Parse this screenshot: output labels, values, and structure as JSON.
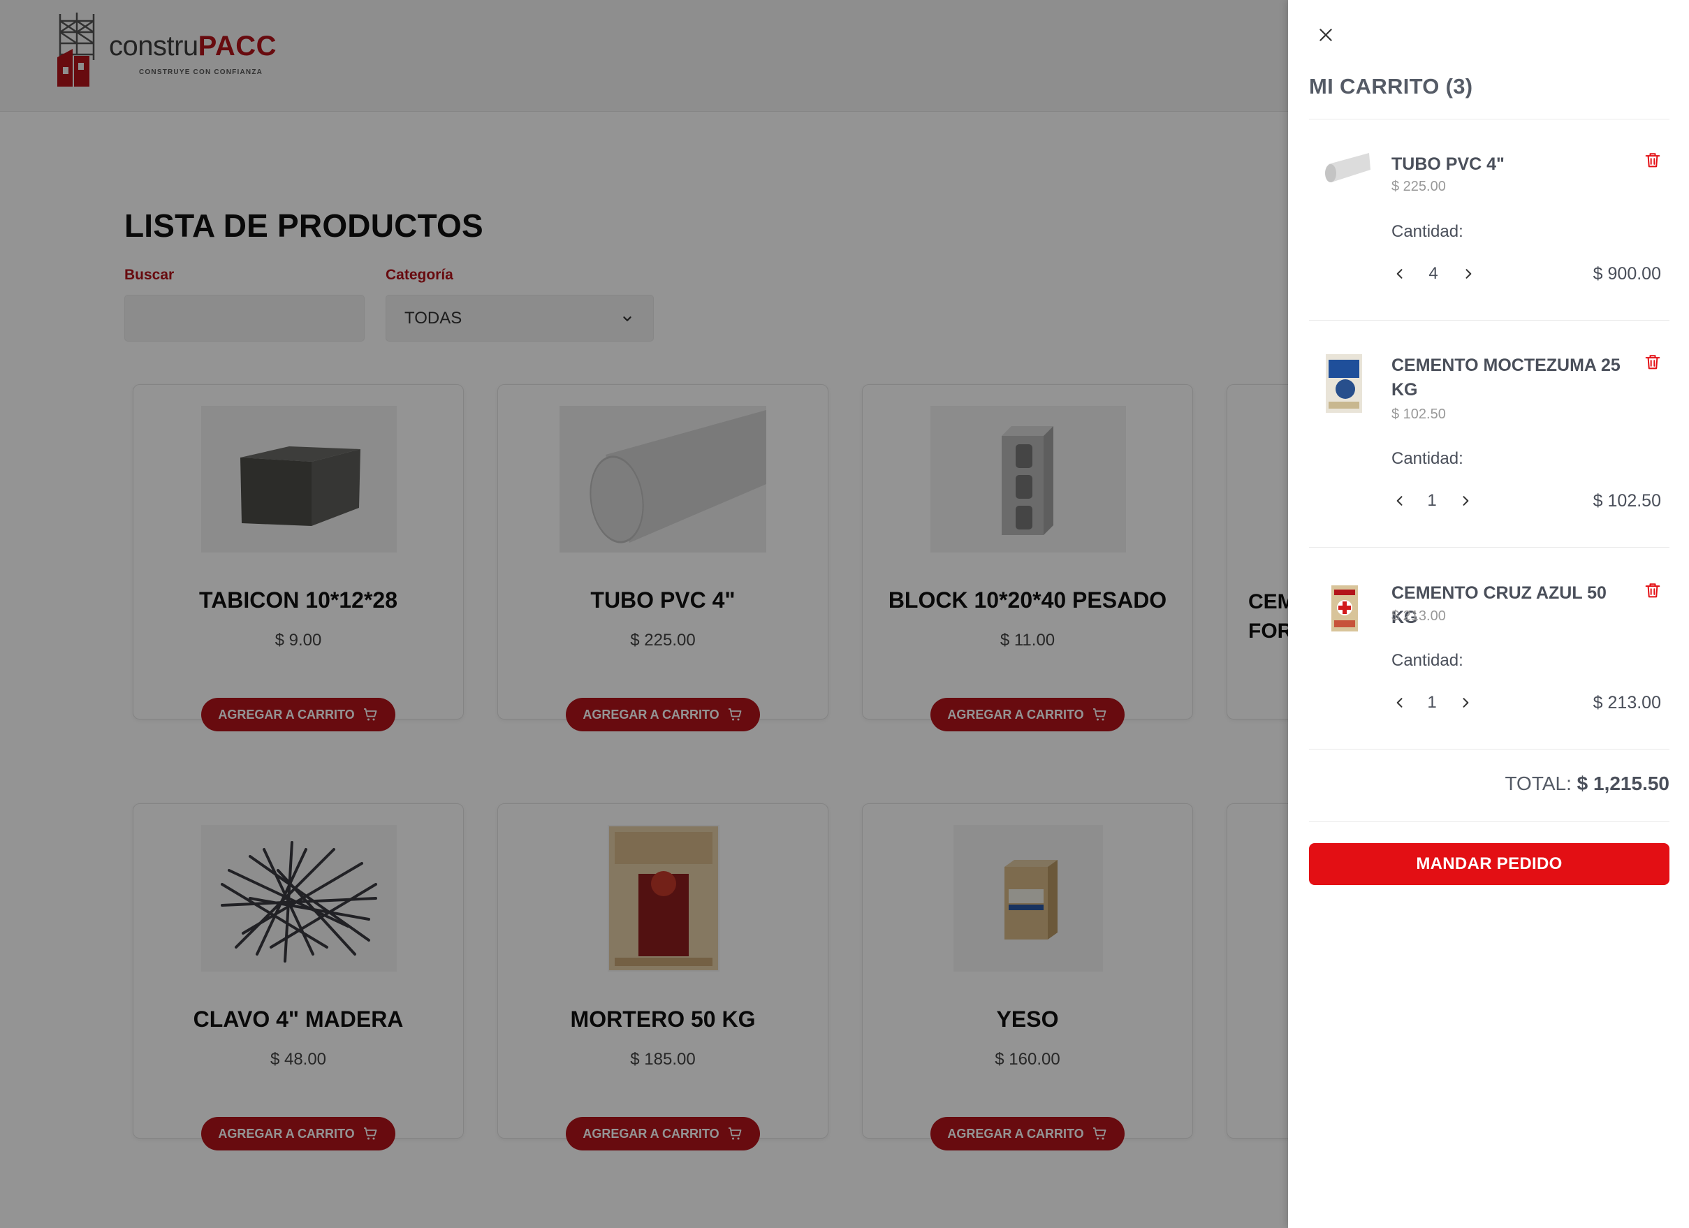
{
  "brand": {
    "name_part1": "constru",
    "name_part2": "PACC",
    "tagline": "CONSTRUYE CON CONFIANZA",
    "colors": {
      "primary": "#b3141b",
      "cta": "#e30f14",
      "dark": "#3d3d3d"
    }
  },
  "main": {
    "title": "LISTA DE PRODUCTOS",
    "search": {
      "label": "Buscar",
      "value": "",
      "placeholder": ""
    },
    "category": {
      "label": "Categoría",
      "selected": "TODAS"
    },
    "add_to_cart_label": "AGREGAR A CARRITO",
    "products": [
      {
        "name": "TABICON 10*12*28",
        "price": "$ 9.00",
        "image_icon": "concrete-brick-icon"
      },
      {
        "name": "TUBO PVC 4\"",
        "price": "$ 225.00",
        "image_icon": "pvc-pipe-icon"
      },
      {
        "name": "BLOCK 10*20*40 PESADO",
        "price": "$ 11.00",
        "image_icon": "cinder-block-icon"
      },
      {
        "name": "CEM\nFOR",
        "price": "",
        "image_icon": ""
      },
      {
        "name": "CLAVO 4\" MADERA",
        "price": "$ 48.00",
        "image_icon": "nails-icon"
      },
      {
        "name": "MORTERO 50 KG",
        "price": "$ 185.00",
        "image_icon": "mortar-bag-icon"
      },
      {
        "name": "YESO",
        "price": "$ 160.00",
        "image_icon": "plaster-bag-icon"
      }
    ]
  },
  "cart": {
    "title": "MI CARRITO (3)",
    "quantity_label": "Cantidad:",
    "items": [
      {
        "name": "TUBO PVC 4\"",
        "unit_price": "$ 225.00",
        "quantity": "4",
        "subtotal": "$ 900.00",
        "image_icon": "pvc-pipe-icon"
      },
      {
        "name": "CEMENTO MOCTEZUMA 25 KG",
        "unit_price": "$ 102.50",
        "quantity": "1",
        "subtotal": "$ 102.50",
        "image_icon": "cement-bag-moctezuma-icon"
      },
      {
        "name": "CEMENTO CRUZ AZUL 50 KG",
        "unit_price": "$ 213.00",
        "quantity": "1",
        "subtotal": "$ 213.00",
        "image_icon": "cement-bag-cruz-azul-icon"
      }
    ],
    "total_label": "TOTAL:",
    "total_value": "$ 1,215.50",
    "send_label": "MANDAR PEDIDO"
  }
}
